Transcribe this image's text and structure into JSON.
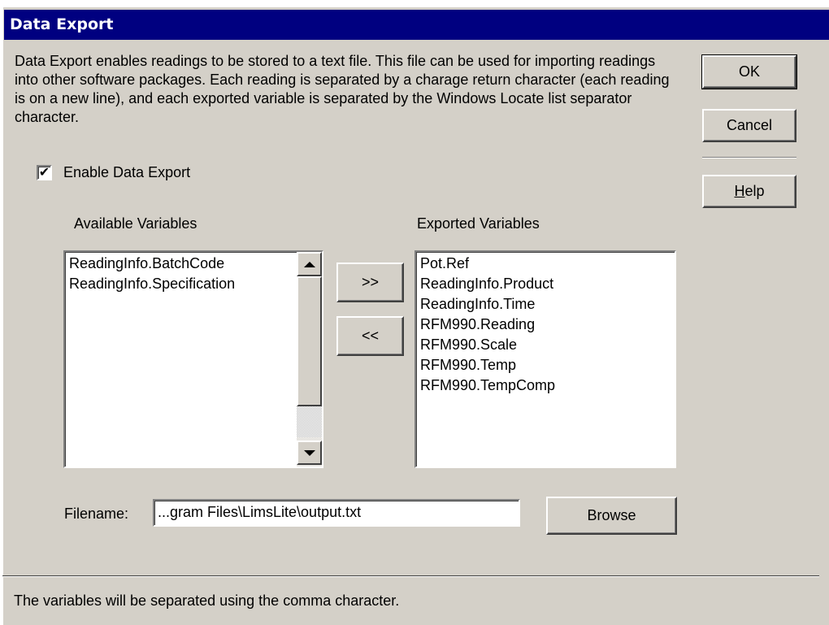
{
  "window": {
    "title": "Data Export"
  },
  "description": "Data Export enables readings to be stored to a text file.  This file can be used for importing readings into other software packages.  Each reading is separated by a charage return character (each reading is on a new line), and each exported variable is separated by the Windows Locate list separator character.",
  "buttons": {
    "ok": "OK",
    "cancel": "Cancel",
    "help": "Help",
    "add": ">>",
    "remove": "<<",
    "browse": "Browse"
  },
  "enable_export": {
    "label": "Enable Data Export",
    "checked": true,
    "check_glyph": "✔"
  },
  "available": {
    "header": "Available Variables",
    "items": [
      "ReadingInfo.BatchCode",
      "ReadingInfo.Specification"
    ]
  },
  "exported": {
    "header": "Exported Variables",
    "items": [
      "Pot.Ref",
      "ReadingInfo.Product",
      "ReadingInfo.Time",
      "RFM990.Reading",
      "RFM990.Scale",
      "RFM990.Temp",
      "RFM990.TempComp"
    ]
  },
  "filename": {
    "label": "Filename:",
    "value": "...gram Files\\LimsLite\\output.txt"
  },
  "status": "The variables will be separated using the comma character.",
  "colors": {
    "face": "#d4d0c8",
    "titlebar": "#000080",
    "title_text": "#ffffff"
  }
}
